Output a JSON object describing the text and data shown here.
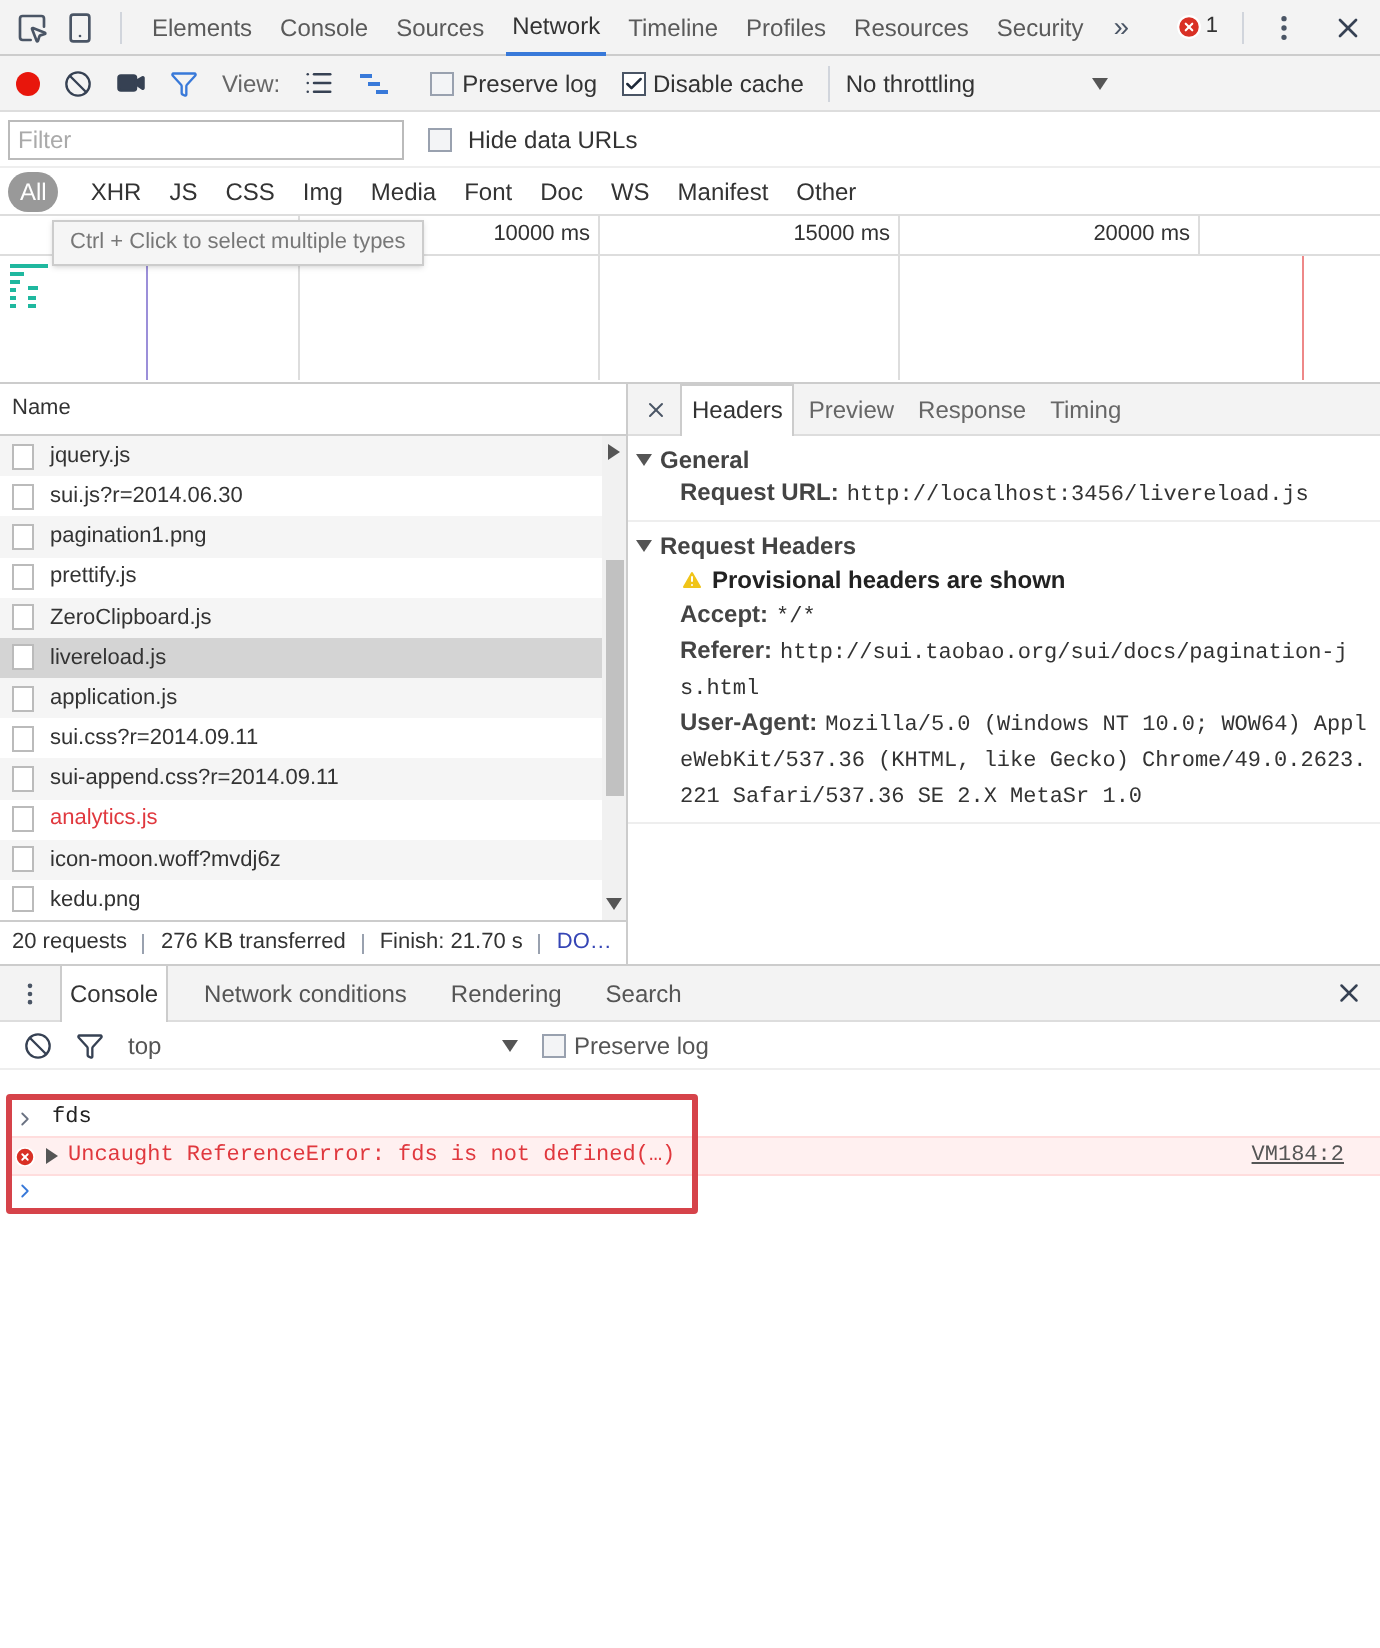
{
  "main_tabs": [
    {
      "label": "Elements",
      "selected": false
    },
    {
      "label": "Console",
      "selected": false
    },
    {
      "label": "Sources",
      "selected": false
    },
    {
      "label": "Network",
      "selected": true
    },
    {
      "label": "Timeline",
      "selected": false
    },
    {
      "label": "Profiles",
      "selected": false
    },
    {
      "label": "Resources",
      "selected": false
    },
    {
      "label": "Security",
      "selected": false
    }
  ],
  "overflow": "»",
  "error_count": "1",
  "toolbar": {
    "view_label": "View:",
    "preserve_log": {
      "label": "Preserve log",
      "checked": false
    },
    "disable_cache": {
      "label": "Disable cache",
      "checked": true
    },
    "throttling": "No throttling"
  },
  "filter": {
    "placeholder": "Filter",
    "hide_data_urls": {
      "label": "Hide data URLs",
      "checked": false
    }
  },
  "type_filters": [
    {
      "label": "All",
      "selected": true
    },
    {
      "label": "XHR",
      "selected": false
    },
    {
      "label": "JS",
      "selected": false
    },
    {
      "label": "CSS",
      "selected": false
    },
    {
      "label": "Img",
      "selected": false
    },
    {
      "label": "Media",
      "selected": false
    },
    {
      "label": "Font",
      "selected": false
    },
    {
      "label": "Doc",
      "selected": false
    },
    {
      "label": "WS",
      "selected": false
    },
    {
      "label": "Manifest",
      "selected": false
    },
    {
      "label": "Other",
      "selected": false
    }
  ],
  "tooltip": "Ctrl + Click to select multiple types",
  "timeline": {
    "ticks": [
      "10000 ms",
      "15000 ms",
      "20000 ms"
    ]
  },
  "requests": {
    "column": "Name",
    "rows": [
      {
        "name": "jquery.js",
        "selected": false,
        "failed": false
      },
      {
        "name": "sui.js?r=2014.06.30",
        "selected": false,
        "failed": false
      },
      {
        "name": "pagination1.png",
        "selected": false,
        "failed": false
      },
      {
        "name": "prettify.js",
        "selected": false,
        "failed": false
      },
      {
        "name": "ZeroClipboard.js",
        "selected": false,
        "failed": false
      },
      {
        "name": "livereload.js",
        "selected": true,
        "failed": false
      },
      {
        "name": "application.js",
        "selected": false,
        "failed": false
      },
      {
        "name": "sui.css?r=2014.09.11",
        "selected": false,
        "failed": false
      },
      {
        "name": "sui-append.css?r=2014.09.11",
        "selected": false,
        "failed": false
      },
      {
        "name": "analytics.js",
        "selected": false,
        "failed": true
      },
      {
        "name": "icon-moon.woff?mvdj6z",
        "selected": false,
        "failed": false
      },
      {
        "name": "kedu.png",
        "selected": false,
        "failed": false
      }
    ]
  },
  "status_bar": [
    "20 requests",
    "276 KB transferred",
    "Finish: 21.70 s",
    "DO…"
  ],
  "details": {
    "tabs": [
      {
        "label": "Headers",
        "selected": true
      },
      {
        "label": "Preview",
        "selected": false
      },
      {
        "label": "Response",
        "selected": false
      },
      {
        "label": "Timing",
        "selected": false
      }
    ],
    "sections": [
      {
        "title": "General",
        "expanded": true,
        "entries": [
          {
            "kind": "field",
            "key": "Request URL:",
            "value": "http://localhost:3456/livereload.js"
          }
        ]
      },
      {
        "title": "Request Headers",
        "expanded": true,
        "entries": [
          {
            "kind": "warning",
            "text": "Provisional headers are shown"
          },
          {
            "kind": "field",
            "key": "Accept:",
            "value": "*/*"
          },
          {
            "kind": "field",
            "key": "Referer:",
            "value": "http://sui.taobao.org/sui/docs/pagination-js.html"
          },
          {
            "kind": "field",
            "key": "User-Agent:",
            "value": "Mozilla/5.0 (Windows NT 10.0; WOW64) AppleWebKit/537.36 (KHTML, like Gecko) Chrome/49.0.2623.221 Safari/537.36 SE 2.X MetaSr 1.0"
          }
        ]
      }
    ]
  },
  "drawer": {
    "tabs": [
      {
        "label": "Console",
        "selected": true
      },
      {
        "label": "Network conditions",
        "selected": false
      },
      {
        "label": "Rendering",
        "selected": false
      },
      {
        "label": "Search",
        "selected": false
      }
    ],
    "context": "top",
    "preserve_log": {
      "label": "Preserve log",
      "checked": false
    },
    "messages": [
      {
        "kind": "input",
        "text": "fds"
      },
      {
        "kind": "error",
        "text": "Uncaught ReferenceError: fds is not defined(…)",
        "source": "VM184:2"
      }
    ]
  }
}
